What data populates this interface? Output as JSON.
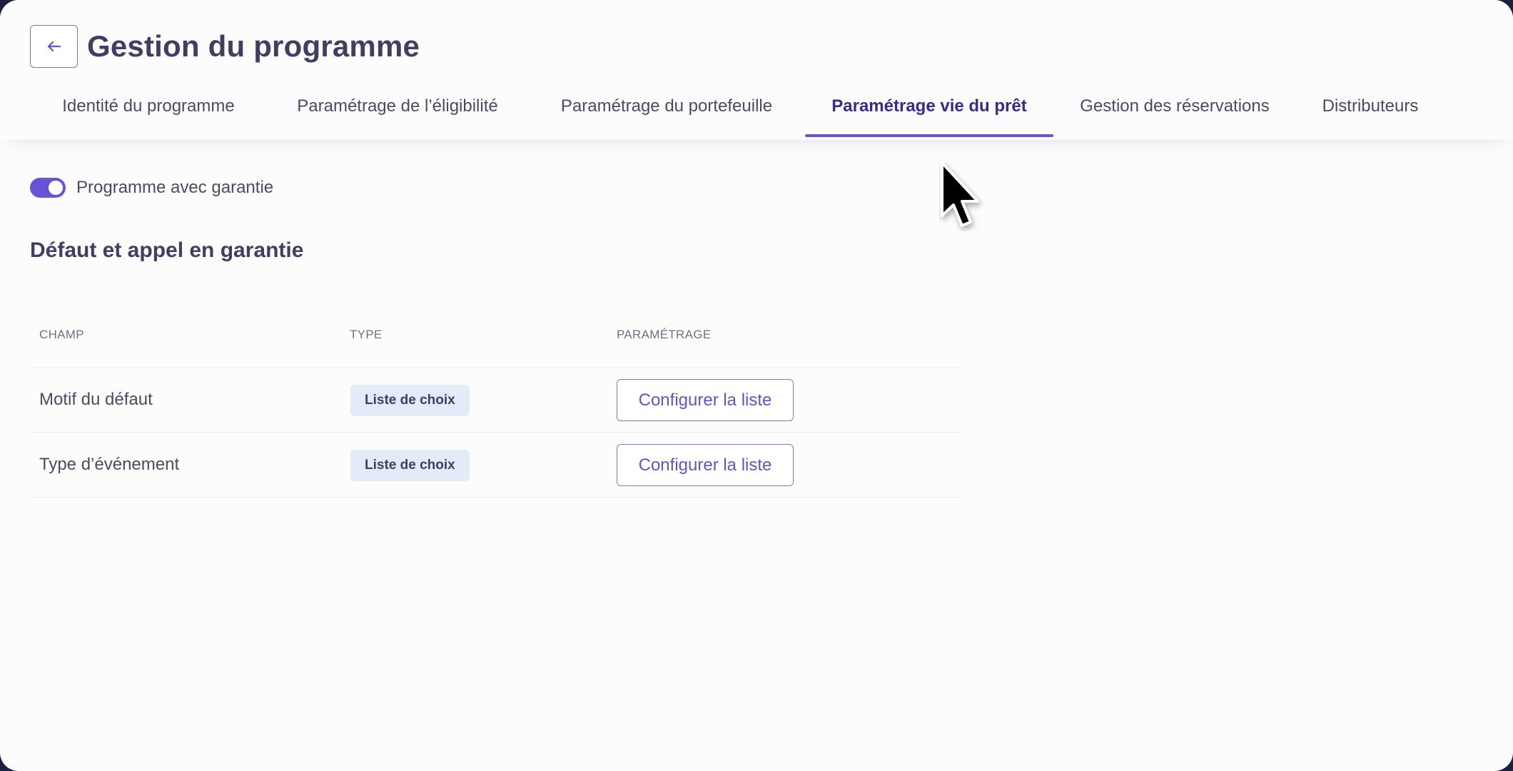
{
  "header": {
    "back_icon": "arrow-left-icon",
    "title": "Gestion du programme"
  },
  "tabs": [
    {
      "label": "Identité du programme",
      "active": false
    },
    {
      "label": "Paramétrage de l’éligibilité",
      "active": false
    },
    {
      "label": "Paramétrage du portefeuille",
      "active": false
    },
    {
      "label": "Paramétrage vie du prêt",
      "active": true
    },
    {
      "label": "Gestion des réservations",
      "active": false
    },
    {
      "label": "Distributeurs",
      "active": false
    }
  ],
  "guarantee_toggle": {
    "label": "Programme avec garantie",
    "checked": true
  },
  "section": {
    "title": "Défaut et appel en garantie"
  },
  "table": {
    "headers": [
      "CHAMP",
      "TYPE",
      "PARAMÉTRAGE"
    ],
    "rows": [
      {
        "field": "Motif du défaut",
        "type": "Liste de choix",
        "action": "Configurer la liste"
      },
      {
        "field": "Type d’événement",
        "type": "Liste de choix",
        "action": "Configurer la liste"
      }
    ]
  },
  "colors": {
    "accent": "#6a52d6",
    "active_tab_text": "#3b2a8a",
    "title_text": "#3e3f63",
    "badge_bg": "#e3ebf8"
  }
}
